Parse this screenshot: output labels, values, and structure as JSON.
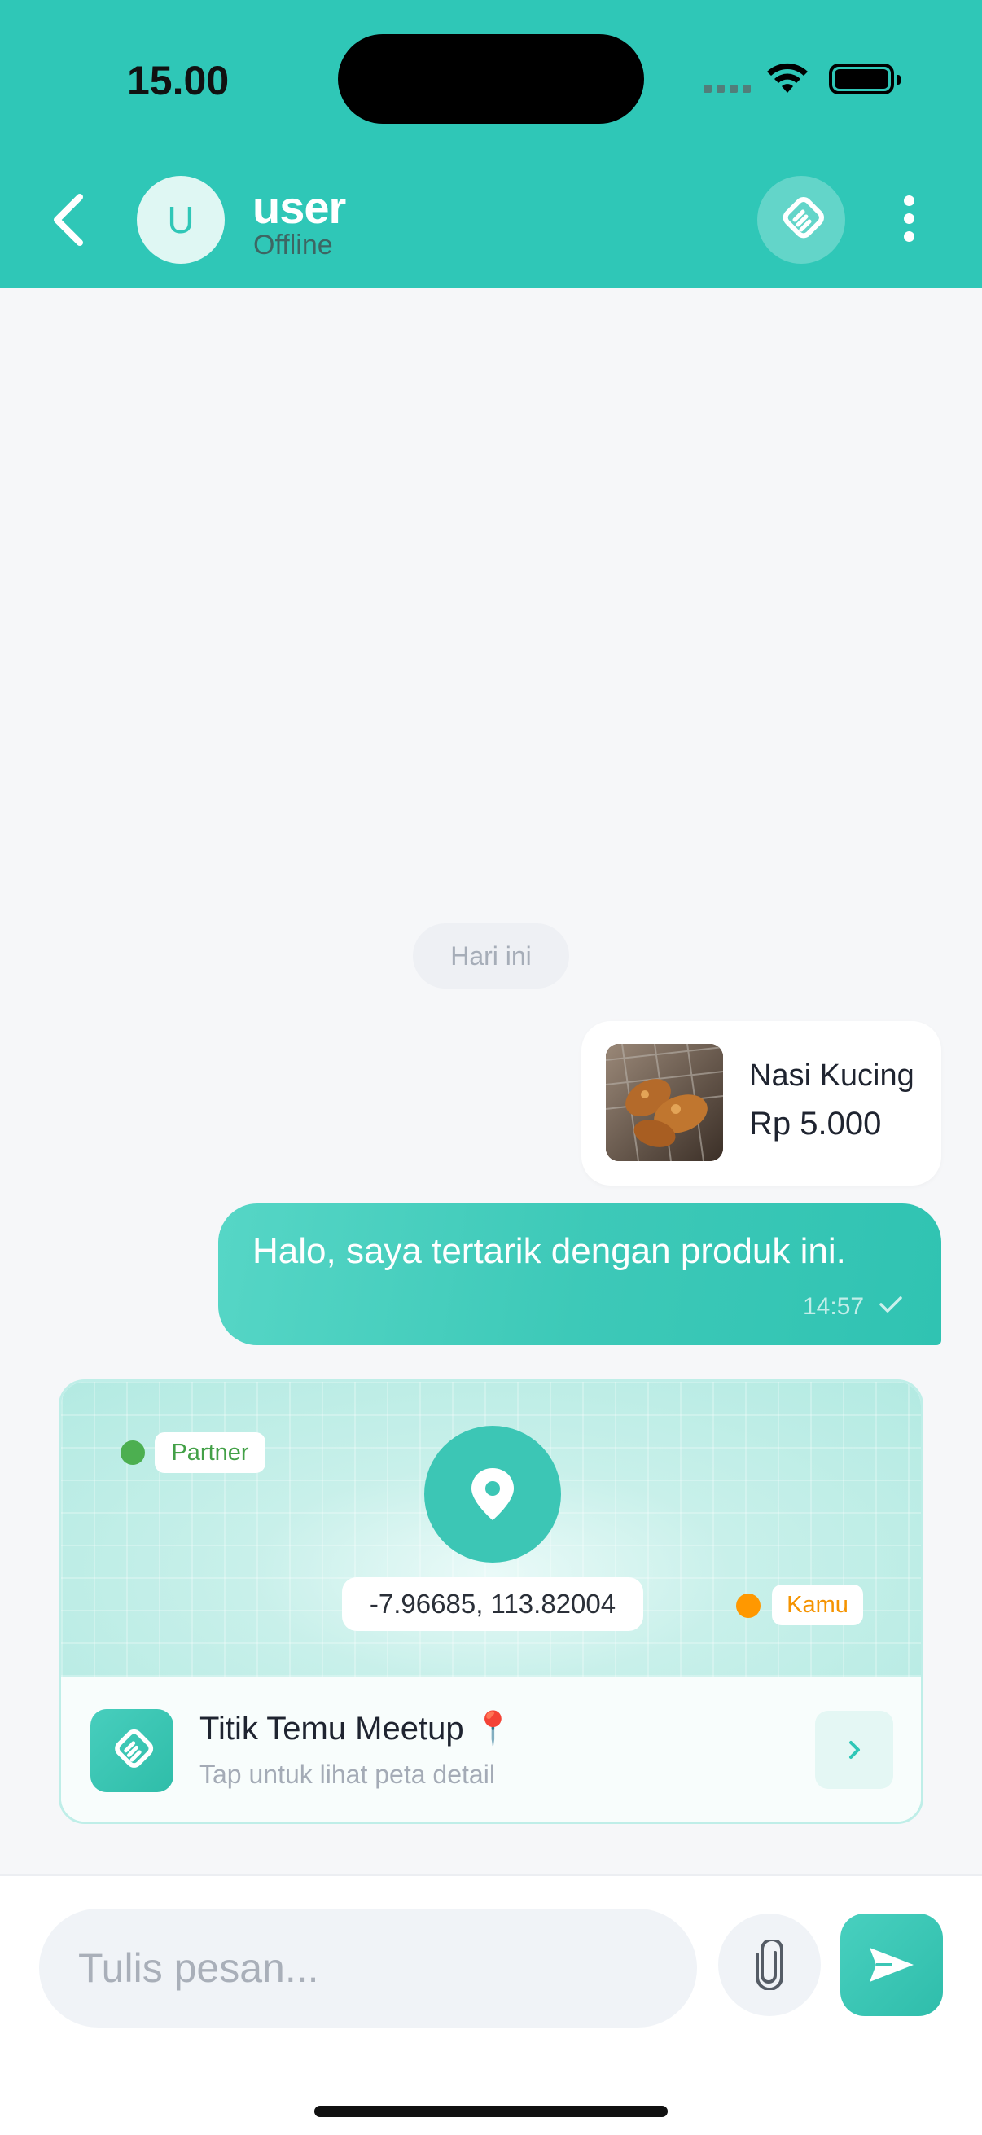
{
  "status_bar": {
    "time": "15.00"
  },
  "header": {
    "avatar_letter": "U",
    "user_name": "user",
    "user_status": "Offline",
    "accent": "#2fc7b7"
  },
  "chat": {
    "date_label": "Hari ini",
    "product": {
      "name": "Nasi Kucing",
      "price": "Rp 5.000"
    },
    "message": {
      "text": "Halo, saya tertarik dengan produk ini.",
      "time": "14:57"
    },
    "meetup": {
      "coordinates": "-7.96685, 113.82004",
      "partner_label": "Partner",
      "you_label": "Kamu",
      "title": "Titik Temu Meetup 📍",
      "subtitle": "Tap untuk lihat peta detail"
    }
  },
  "composer": {
    "placeholder": "Tulis pesan..."
  },
  "icons": [
    "back-icon",
    "handshake-icon",
    "more-icon",
    "location-pin-icon",
    "chevron-right-icon",
    "paperclip-icon",
    "send-icon",
    "check-icon",
    "wifi-icon",
    "battery-icon"
  ]
}
